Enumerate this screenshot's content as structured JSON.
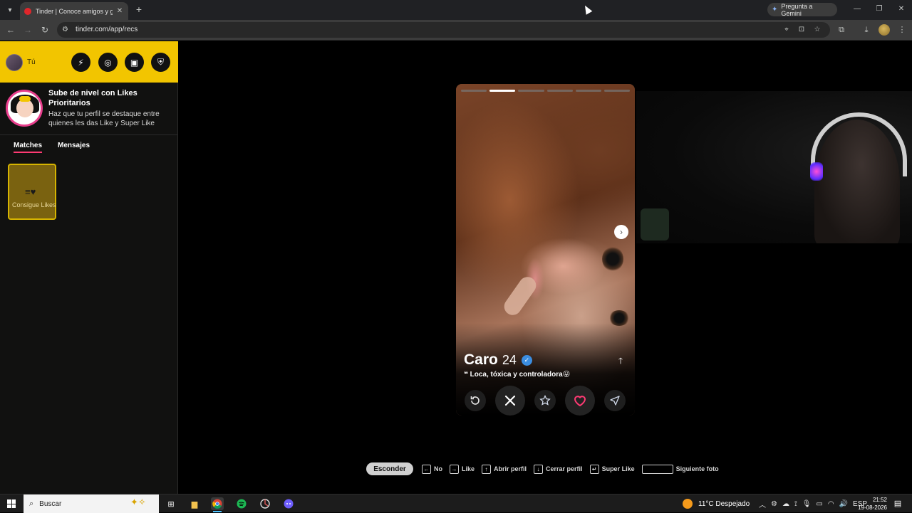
{
  "browser": {
    "tab_title": "Tinder | Conoce amigos y gente",
    "gemini_label": "Pregunta a Gemini",
    "url": "tinder.com/app/recs"
  },
  "sidebar": {
    "me_label": "Tú",
    "promo": {
      "title": "Sube de nivel con Likes Prioritarios",
      "description": "Haz que tu perfil se destaque entre quienes les das Like y Super Like"
    },
    "tabs": [
      {
        "label": "Matches",
        "active": true
      },
      {
        "label": "Mensajes",
        "active": false
      }
    ],
    "likes_card_label": "Consigue Likes"
  },
  "profile": {
    "name": "Caro",
    "age": "24",
    "bio": "Loca, tóxica y controladora😛",
    "bio_quote": "❝",
    "photo_count": 6,
    "active_photo": 2
  },
  "shortcuts": {
    "hide_label": "Esconder",
    "items": [
      {
        "key": "←",
        "label": "No"
      },
      {
        "key": "→",
        "label": "Like"
      },
      {
        "key": "↑",
        "label": "Abrir perfil"
      },
      {
        "key": "↓",
        "label": "Cerrar perfil"
      },
      {
        "key": "↵",
        "label": "Super Like"
      },
      {
        "key": "",
        "label": "Siguiente foto"
      }
    ]
  },
  "taskbar": {
    "search_placeholder": "Buscar",
    "weather": "11°C  Despejado",
    "lang": "ESP",
    "time": "21:52",
    "date": "19-08-2026"
  },
  "colors": {
    "tinder_gold": "#f2c500",
    "tinder_pink": "#fd3a73",
    "verified_blue": "#3b8de0"
  }
}
